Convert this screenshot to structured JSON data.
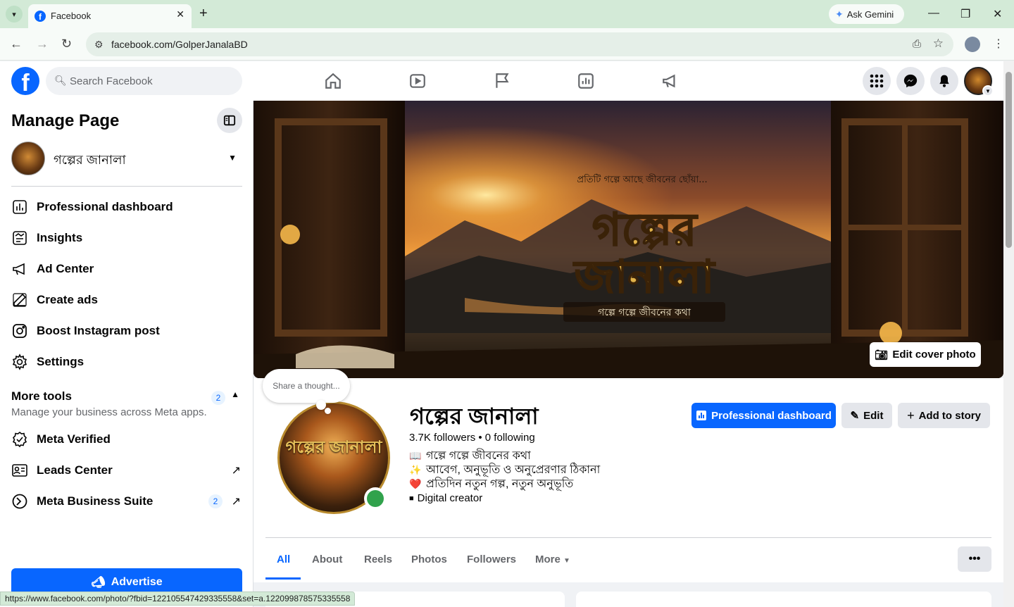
{
  "browser": {
    "tab_title": "Facebook",
    "new_tab": "+",
    "ask_gemini": "Ask Gemini",
    "url": "facebook.com/GolperJanalaBD",
    "status_url": "https://www.facebook.com/photo/?fbid=122105547429335558&set=a.122099878575335558"
  },
  "fb": {
    "search_placeholder": "Search Facebook"
  },
  "sidebar": {
    "title": "Manage Page",
    "page_name": "গল্পের জানালা",
    "items": [
      {
        "label": "Professional dashboard",
        "icon": "dashboard-icon"
      },
      {
        "label": "Insights",
        "icon": "insights-icon"
      },
      {
        "label": "Ad Center",
        "icon": "megaphone-icon"
      },
      {
        "label": "Create ads",
        "icon": "pencil-icon"
      },
      {
        "label": "Boost Instagram post",
        "icon": "instagram-icon"
      },
      {
        "label": "Settings",
        "icon": "gear-icon"
      }
    ],
    "more_tools": {
      "title": "More tools",
      "subtitle": "Manage your business across Meta apps.",
      "badge": "2"
    },
    "tools": [
      {
        "label": "Meta Verified",
        "icon": "verified-icon"
      },
      {
        "label": "Leads Center",
        "icon": "leads-icon"
      },
      {
        "label": "Meta Business Suite",
        "icon": "meta-icon",
        "badge": "2"
      }
    ],
    "advertise": "Advertise"
  },
  "cover": {
    "tagline_top": "প্রতিটি গল্পে আছে জীবনের ছোঁয়া...",
    "title_line1": "গল্পের",
    "title_line2": "জানালা",
    "tagline_bottom": "গল্পে গল্পে জীবনের কথা",
    "edit_cover": "Edit cover photo"
  },
  "profile": {
    "thought_bubble": "Share a thought...",
    "avatar_text": "গল্পের জানালা",
    "name": "গল্পের জানালা",
    "followers": "3.7K followers • 0 following",
    "bio": [
      {
        "emoji": "📖",
        "text": "গল্পে গল্পে জীবনের কথা"
      },
      {
        "emoji": "✨",
        "text": "আবেগ, অনুভূতি ও অনুপ্রেরণার ঠিকানা"
      },
      {
        "emoji": "❤️",
        "text": "প্রতিদিন নতুন গল্প, নতুন অনুভূতি"
      }
    ],
    "category": "Digital creator",
    "buttons": {
      "dashboard": "Professional dashboard",
      "edit": "Edit",
      "add_story": "Add to story"
    },
    "tabs": [
      "All",
      "About",
      "Reels",
      "Photos",
      "Followers",
      "More"
    ],
    "more_dots": "•••"
  },
  "colors": {
    "fb_blue": "#0866ff",
    "chrome_green": "#d3ead7",
    "online_green": "#31a24c"
  }
}
